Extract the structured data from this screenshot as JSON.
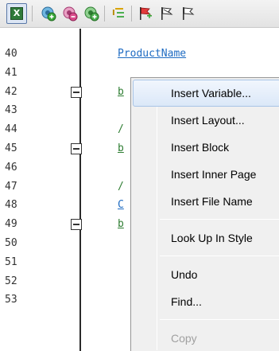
{
  "toolbar": {
    "buttons": [
      {
        "name": "insert-variable-tool-icon",
        "glyph": "X"
      },
      {
        "name": "add-green-circle-icon"
      },
      {
        "name": "add-pink-circle-icon"
      },
      {
        "name": "add-green-circle-alt-icon"
      },
      {
        "name": "insert-text-icon"
      },
      {
        "name": "red-flag-icon"
      },
      {
        "name": "flag-outline-icon"
      },
      {
        "name": "flag-outline-alt-icon"
      }
    ]
  },
  "editor": {
    "lines": [
      {
        "num": "40",
        "text": "ProductName",
        "color": "#1e6bc2",
        "fold": false
      },
      {
        "num": "41",
        "text": "",
        "fold": false
      },
      {
        "num": "42",
        "text": "b",
        "color": "#2e7d32",
        "fold": true
      },
      {
        "num": "43",
        "text": "",
        "fold": false
      },
      {
        "num": "44",
        "text": "/",
        "color": "#2e7d32",
        "fold": false,
        "plain": true
      },
      {
        "num": "45",
        "text": "b",
        "color": "#2e7d32",
        "fold": true
      },
      {
        "num": "46",
        "text": "",
        "fold": false
      },
      {
        "num": "47",
        "text": "/",
        "color": "#2e7d32",
        "fold": false,
        "plain": true
      },
      {
        "num": "48",
        "text": "C",
        "color": "#1e6bc2",
        "fold": false
      },
      {
        "num": "49",
        "text": "b",
        "color": "#2e7d32",
        "fold": true
      },
      {
        "num": "50",
        "text": "",
        "fold": false
      },
      {
        "num": "51",
        "text": "",
        "fold": false
      },
      {
        "num": "52",
        "text": "",
        "fold": false
      },
      {
        "num": "53",
        "text": "",
        "fold": false
      }
    ]
  },
  "context_menu": {
    "items": [
      {
        "label": "Insert Variable...",
        "highlighted": true
      },
      {
        "label": "Insert Layout..."
      },
      {
        "label": "Insert Block"
      },
      {
        "label": "Insert Inner Page"
      },
      {
        "label": "Insert File Name"
      },
      {
        "separator": true
      },
      {
        "label": "Look Up In Style"
      },
      {
        "separator": true
      },
      {
        "label": "Undo"
      },
      {
        "label": "Find..."
      },
      {
        "separator": true
      },
      {
        "label": "Copy",
        "disabled": true
      }
    ]
  }
}
